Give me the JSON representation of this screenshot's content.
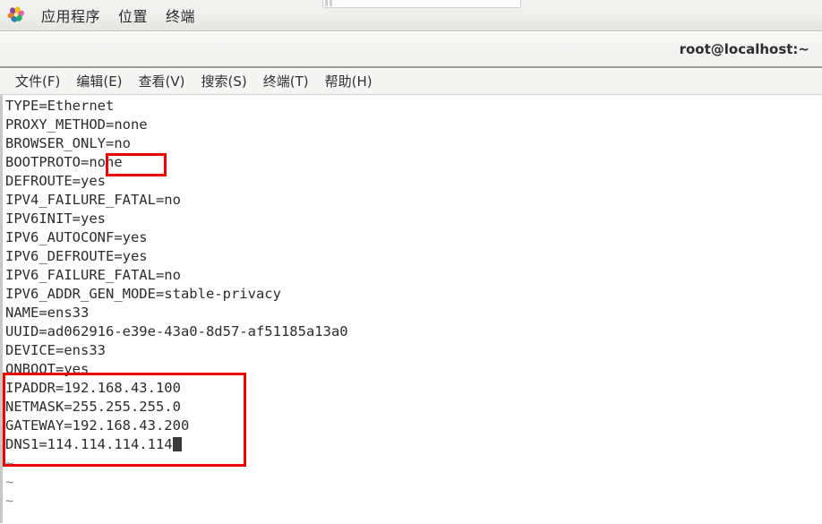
{
  "desktop": {
    "panel": {
      "logo_icon": "gnome-foot-icon",
      "menus": [
        {
          "label": "应用程序",
          "name": "panel-menu-applications"
        },
        {
          "label": "位置",
          "name": "panel-menu-places"
        },
        {
          "label": "终端",
          "name": "panel-menu-terminal"
        }
      ]
    },
    "background_window": {
      "name": "partial-background-window"
    }
  },
  "terminal": {
    "titlebar": {
      "title": "root@localhost:~"
    },
    "menubar": [
      {
        "label": "文件(F)",
        "name": "menu-file"
      },
      {
        "label": "编辑(E)",
        "name": "menu-edit"
      },
      {
        "label": "查看(V)",
        "name": "menu-view"
      },
      {
        "label": "搜索(S)",
        "name": "menu-search"
      },
      {
        "label": "终端(T)",
        "name": "menu-terminal"
      },
      {
        "label": "帮助(H)",
        "name": "menu-help"
      }
    ],
    "content_lines": [
      "TYPE=Ethernet",
      "PROXY_METHOD=none",
      "BROWSER_ONLY=no",
      "BOOTPROTO=none",
      "DEFROUTE=yes",
      "IPV4_FAILURE_FATAL=no",
      "IPV6INIT=yes",
      "IPV6_AUTOCONF=yes",
      "IPV6_DEFROUTE=yes",
      "IPV6_FAILURE_FATAL=no",
      "IPV6_ADDR_GEN_MODE=stable-privacy",
      "NAME=ens33",
      "UUID=ad062916-e39e-43a0-8d57-af51185a13a0",
      "DEVICE=ens33",
      "ONBOOT=yes",
      "IPADDR=192.168.43.100",
      "NETMASK=255.255.255.0",
      "GATEWAY=192.168.43.200",
      "DNS1=114.114.114.114"
    ],
    "cursor_line_index": 18,
    "empty_markers": [
      "~",
      "~",
      "~"
    ]
  },
  "annotations": {
    "accent_color": "#ee0000",
    "boxes": [
      {
        "name": "highlight-bootproto-value",
        "target": "BOOTPROTO=none"
      },
      {
        "name": "highlight-static-ip-block",
        "target": "IPADDR/NETMASK/GATEWAY/DNS1"
      }
    ]
  }
}
